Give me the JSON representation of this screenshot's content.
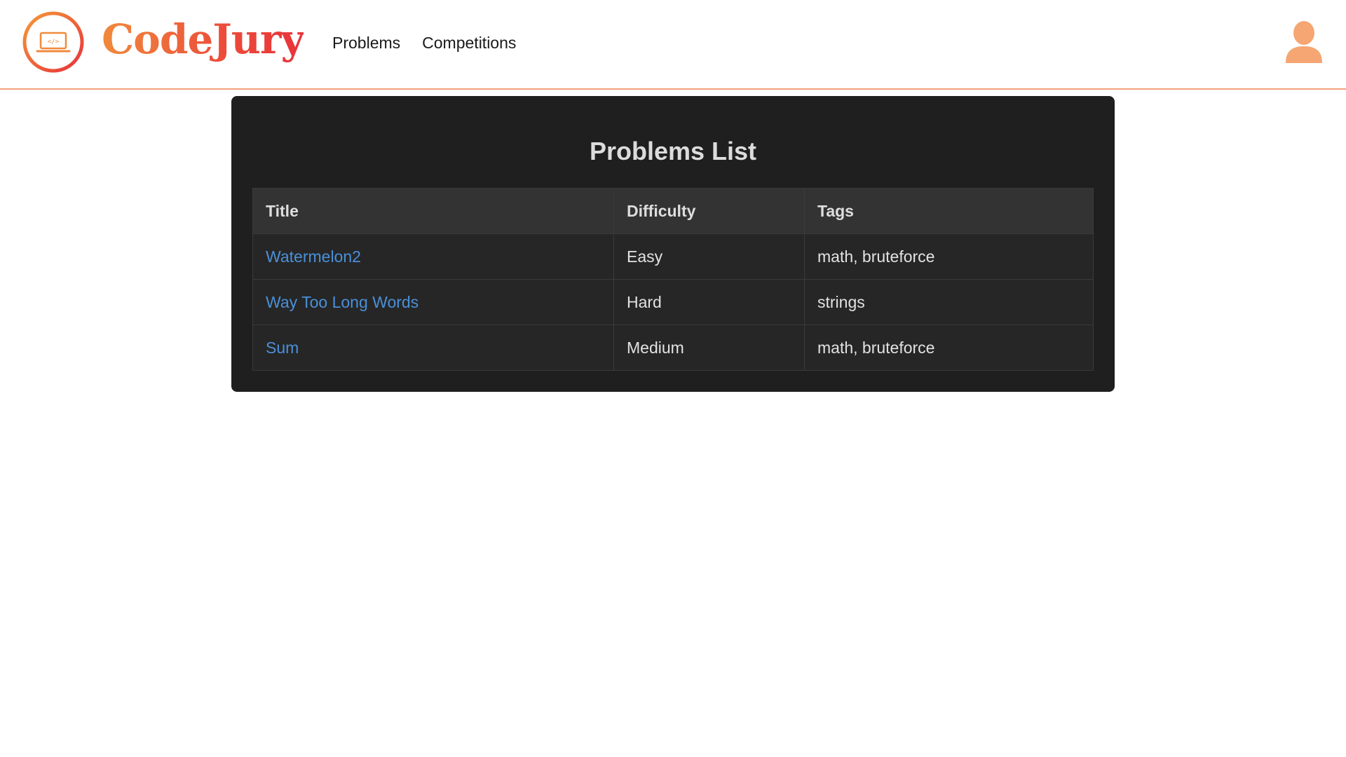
{
  "header": {
    "brand_name": "CodeJury",
    "logo_icon": "laptop-code-icon",
    "nav": [
      {
        "label": "Problems"
      },
      {
        "label": "Competitions"
      }
    ],
    "avatar_icon": "user-avatar-icon"
  },
  "main": {
    "title": "Problems List",
    "columns": [
      "Title",
      "Difficulty",
      "Tags"
    ],
    "rows": [
      {
        "title": "Watermelon2",
        "difficulty": "Easy",
        "tags": "math, bruteforce"
      },
      {
        "title": "Way Too Long Words",
        "difficulty": "Hard",
        "tags": "strings"
      },
      {
        "title": "Sum",
        "difficulty": "Medium",
        "tags": "math, bruteforce"
      }
    ]
  },
  "colors": {
    "accent": "#f4a07c",
    "brand_gradient_start": "#f08a3c",
    "brand_gradient_end": "#e8323a",
    "link": "#4a90d9",
    "easy": "#1fdc1f",
    "hard": "#e8141c",
    "medium": "#f3c31a",
    "panel_bg": "#1f1f1f"
  }
}
